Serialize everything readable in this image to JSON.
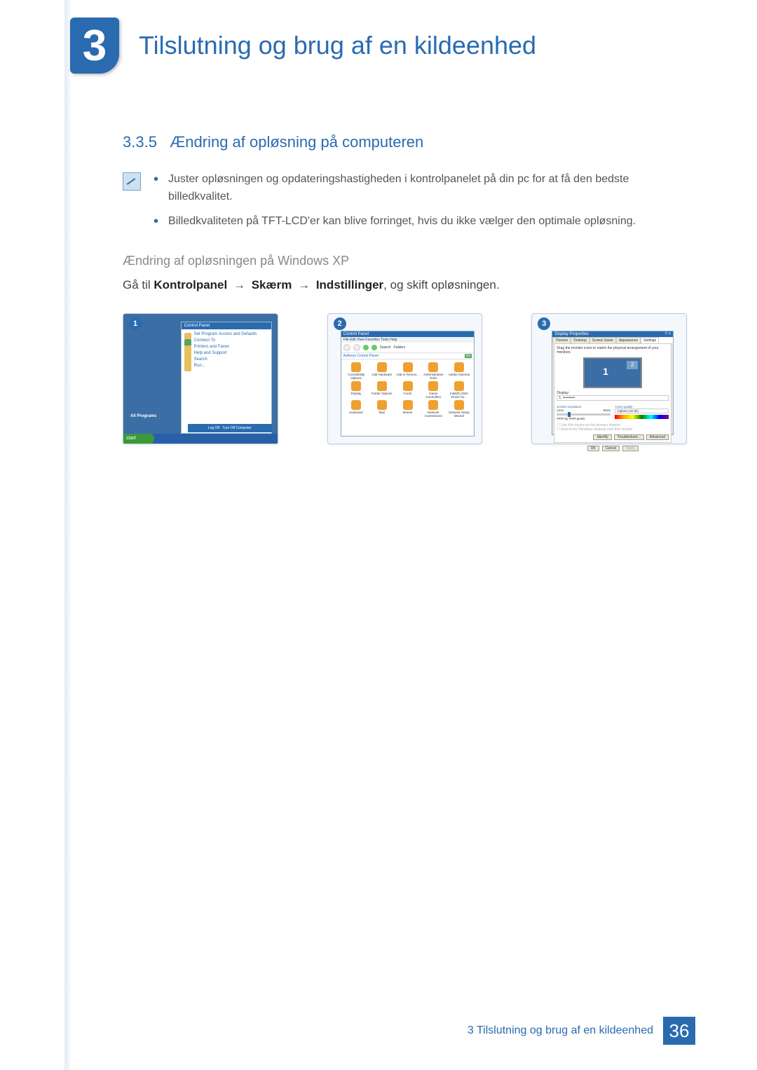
{
  "chapter": {
    "number": "3",
    "title": "Tilslutning og brug af en kildeenhed"
  },
  "section": {
    "number": "3.3.5",
    "heading": "Ændring af opløsning på computeren"
  },
  "bullets": [
    "Juster opløsningen og opdateringshastigheden i kontrolpanelet på din pc for at få den bedste billedkvalitet.",
    "Billedkvaliteten på TFT-LCD'er kan blive forringet, hvis du ikke vælger den optimale opløsning."
  ],
  "subheading": "Ændring af opløsningen på Windows XP",
  "path": {
    "prefix": "Gå til ",
    "p1": "Kontrolpanel",
    "p2": "Skærm",
    "p3": "Indstillinger",
    "suffix": ", og skift opløsningen."
  },
  "screenshots": {
    "s1": {
      "num": "1",
      "menu_header": "Control Panel",
      "items": [
        "Control Panel",
        "Set Program Access and Defaults",
        "Connect To",
        "Printers and Faxes",
        "Help and Support",
        "Search",
        "Run..."
      ],
      "all_programs": "All Programs",
      "logoff": "Log Off",
      "turnoff": "Turn Off Computer",
      "start": "start"
    },
    "s2": {
      "num": "2",
      "title": "Control Panel",
      "menus": "File   Edit   View   Favorites   Tools   Help",
      "search": "Search",
      "folders": "Folders",
      "address_label": "Address",
      "address": "Control Panel",
      "go": "Go",
      "icons": [
        "Accessibility Options",
        "Add Hardware",
        "Add or Remov...",
        "Administrative Tools",
        "Adobe Gamma",
        "Display",
        "Folder Options",
        "Fonts",
        "Game Controllers",
        "Intel(R) GMA Driver for...",
        "Keyboard",
        "Mail",
        "Mouse",
        "Network Connections",
        "Network Setup Wizard"
      ]
    },
    "s3": {
      "num": "3",
      "title": "Display Properties",
      "tabs": [
        "Themes",
        "Desktop",
        "Screen Saver",
        "Appearance",
        "Settings"
      ],
      "drag_text": "Drag the monitor icons to match the physical arrangement of your monitors.",
      "mon1": "1",
      "mon2": "2",
      "display_label": "Display:",
      "display_value": "1. ••••••••••",
      "res_label": "Screen resolution",
      "res_less": "Less",
      "res_more": "More",
      "res_value": "#### by #### pixels",
      "color_label": "Color quality",
      "color_value": "Highest (32 bit)",
      "chk1": "Use this device as the primary monitor",
      "chk2": "Extend my Windows desktop onto this monitor",
      "btn_identify": "Identify",
      "btn_troubleshoot": "Troubleshoot...",
      "btn_advanced": "Advanced",
      "btn_ok": "OK",
      "btn_cancel": "Cancel",
      "btn_apply": "Apply"
    }
  },
  "footer": {
    "chapter_ref": "3 Tilslutning og brug af en kildeenhed",
    "page": "36"
  }
}
